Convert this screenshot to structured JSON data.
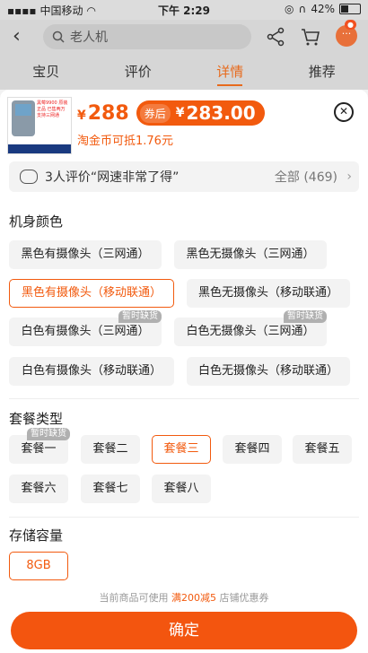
{
  "status_bar": {
    "carrier": "中国移动",
    "time": "下午 2:29",
    "battery": "42%",
    "battery_level": 0.42
  },
  "nav": {
    "search_placeholder": "老人机",
    "more_badge": "···"
  },
  "tabs": [
    {
      "label": "宝贝"
    },
    {
      "label": "评价"
    },
    {
      "label": "详情",
      "active": true
    },
    {
      "label": "推荐"
    }
  ],
  "product": {
    "thumb_text": "黑莓9900 原装正品 已售两万 支持三网通",
    "thumb_strip": "三网通 超级正品 学生版同手机",
    "currency": "¥",
    "price": "288",
    "coupon_label": "券后",
    "coupon_price": "283.00",
    "coin_note": "淘金币可抵1.76元"
  },
  "review": {
    "summary": "3人评价“网速非常了得”",
    "all": "全部 (469)"
  },
  "sections": {
    "color": {
      "title": "机身颜色",
      "options": [
        {
          "label": "黑色有摄像头（三网通）"
        },
        {
          "label": "黑色无摄像头（三网通）"
        },
        {
          "label": "黑色有摄像头（移动联通）",
          "selected": true
        },
        {
          "label": "黑色无摄像头（移动联通）"
        },
        {
          "label": "白色有摄像头（三网通）",
          "soldout": "暂时缺货"
        },
        {
          "label": "白色无摄像头（三网通）",
          "soldout": "暂时缺货"
        },
        {
          "label": "白色有摄像头（移动联通）"
        },
        {
          "label": "白色无摄像头（移动联通）"
        }
      ]
    },
    "package": {
      "title": "套餐类型",
      "options": [
        {
          "label": "套餐一",
          "soldout": "暂时缺货"
        },
        {
          "label": "套餐二"
        },
        {
          "label": "套餐三",
          "selected": true
        },
        {
          "label": "套餐四"
        },
        {
          "label": "套餐五"
        },
        {
          "label": "套餐六"
        },
        {
          "label": "套餐七"
        },
        {
          "label": "套餐八"
        }
      ]
    },
    "storage": {
      "title": "存储容量",
      "options": [
        {
          "label": "8GB",
          "selected": true
        }
      ]
    }
  },
  "coupon_note": {
    "prefix": "当前商品可使用 ",
    "highlight": "满200减5",
    "suffix": " 店铺优惠券"
  },
  "confirm_label": "确定",
  "colors": {
    "accent": "#f25a0e",
    "tab_active": "#e76a1c"
  }
}
